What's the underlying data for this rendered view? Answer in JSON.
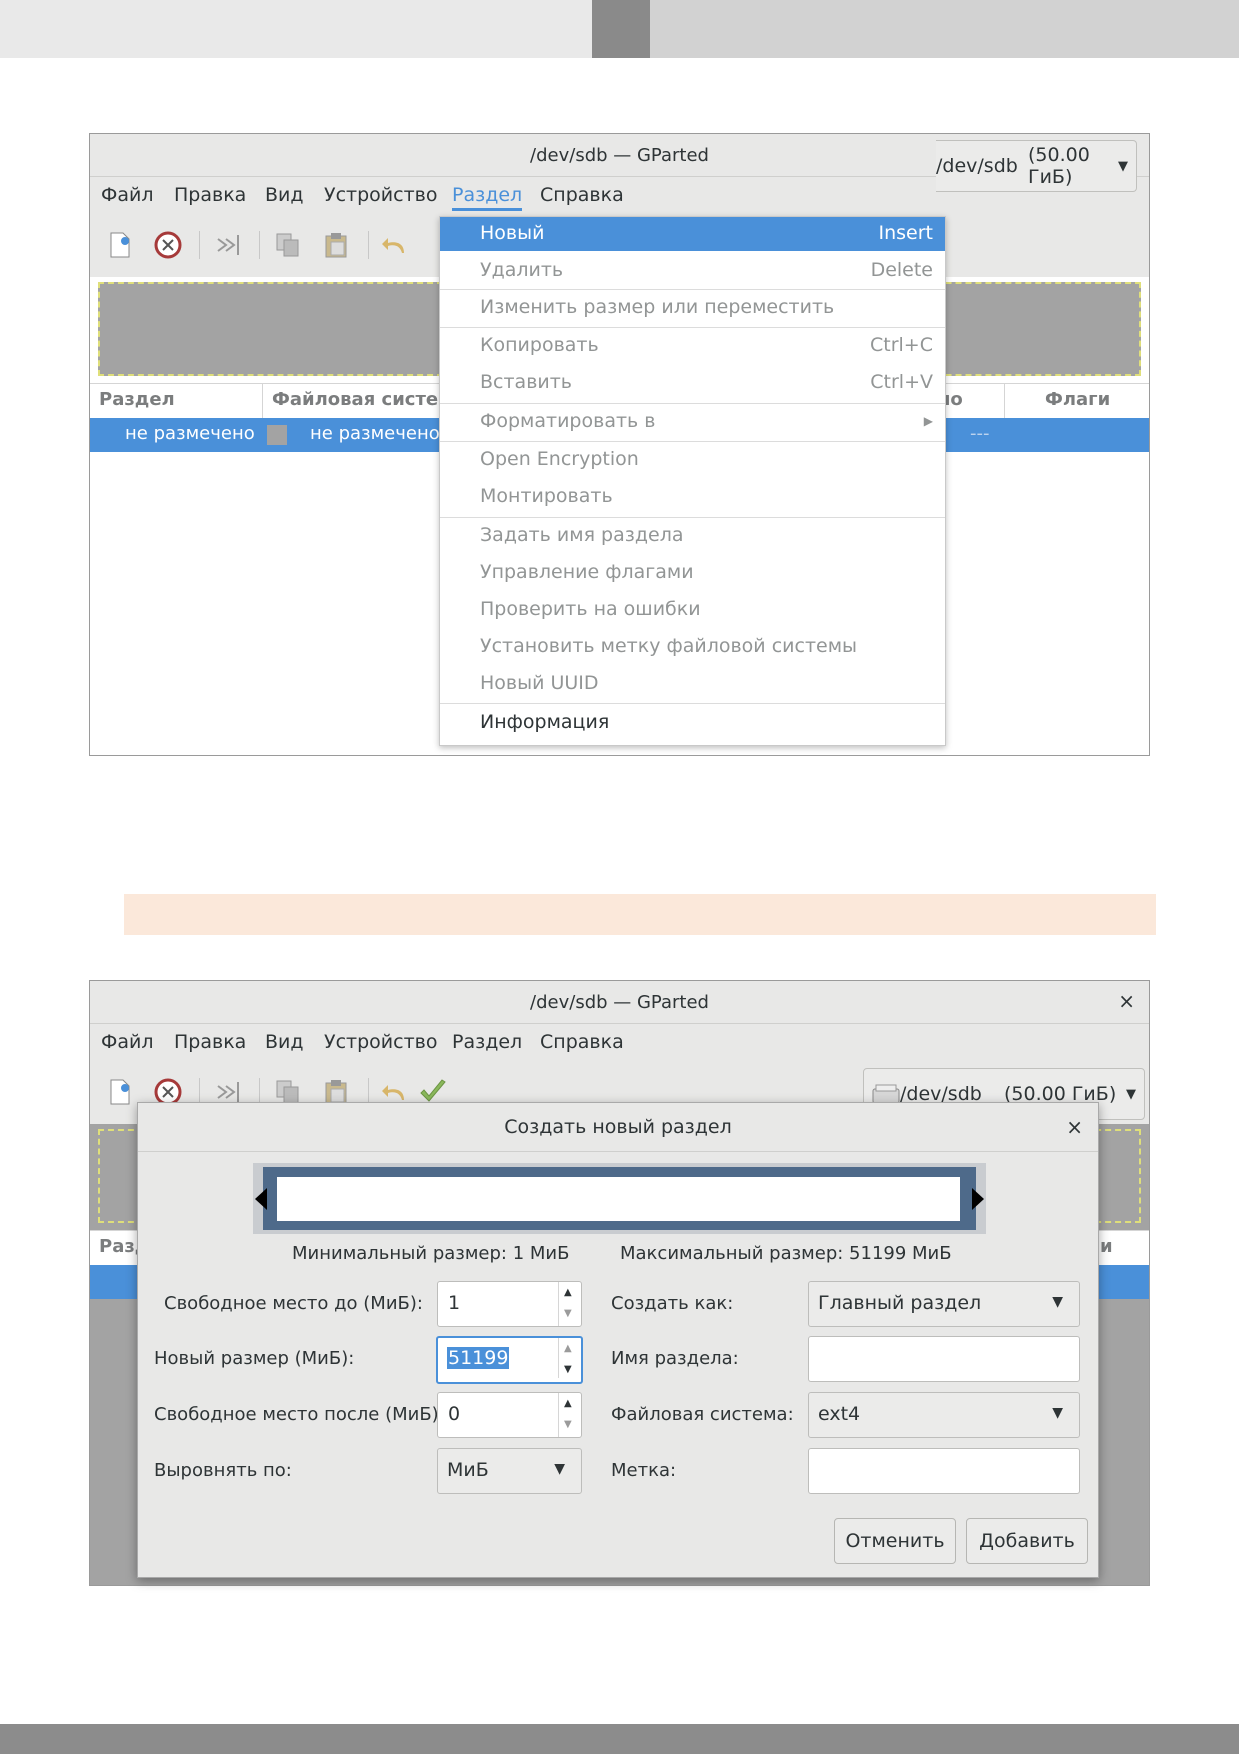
{
  "window": {
    "title": "/dev/sdb — GParted",
    "close_glyph": "×",
    "menu": [
      "Файл",
      "Правка",
      "Вид",
      "Устройство",
      "Раздел",
      "Справка"
    ],
    "device_path": "/dev/sdb",
    "device_size": "(50.00 ГиБ)",
    "columns": {
      "partition": "Раздел",
      "filesystem": "Файловая система",
      "filesystem_partial": "Файловая систем",
      "used_partial": "но",
      "flags": "Флаги",
      "partial_right": "и"
    },
    "row": {
      "partition": "не размечено",
      "filesystem": "не размечено",
      "flags": "---"
    }
  },
  "partition_menu": {
    "items": [
      {
        "label": "Новый",
        "accel": "Insert"
      },
      {
        "label": "Удалить",
        "accel": "Delete"
      },
      {
        "label": "Изменить размер или переместить",
        "accel": ""
      },
      {
        "label": "Копировать",
        "accel": "Ctrl+C"
      },
      {
        "label": "Вставить",
        "accel": "Ctrl+V"
      },
      {
        "label": "Форматировать в",
        "accel": ""
      },
      {
        "label": "Open Encryption",
        "accel": ""
      },
      {
        "label": "Монтировать",
        "accel": ""
      },
      {
        "label": "Задать имя раздела",
        "accel": ""
      },
      {
        "label": "Управление флагами",
        "accel": ""
      },
      {
        "label": "Проверить на ошибки",
        "accel": ""
      },
      {
        "label": "Установить метку файловой системы",
        "accel": ""
      },
      {
        "label": "Новый UUID",
        "accel": ""
      },
      {
        "label": "Информация",
        "accel": ""
      }
    ]
  },
  "dialog": {
    "title": "Создать новый раздел",
    "min_size": "Минимальный размер: 1 МиБ",
    "max_size": "Максимальный размер: 51199 МиБ",
    "free_before_label": "Свободное место до (МиБ):",
    "free_before_value": "1",
    "new_size_label": "Новый размер (МиБ):",
    "new_size_value": "51199",
    "free_after_label": "Свободное место после (МиБ):",
    "free_after_value": "0",
    "align_label": "Выровнять по:",
    "align_value": "МиБ",
    "create_as_label": "Создать как:",
    "create_as_value": "Главный раздел",
    "part_name_label": "Имя раздела:",
    "part_name_value": "",
    "fs_label": "Файловая система:",
    "fs_value": "ext4",
    "label_label": "Метка:",
    "label_value": "",
    "cancel": "Отменить",
    "add": "Добавить"
  },
  "icons": [
    "new-partition-icon",
    "delete-icon",
    "resize-move-icon",
    "copy-icon",
    "paste-icon",
    "undo-icon",
    "apply-icon",
    "disk-icon",
    "dropdown-arrow-icon",
    "submenu-arrow-icon",
    "spin-up-icon",
    "spin-down-icon"
  ],
  "colors": {
    "accent": "#4a90d9",
    "window_bg": "#e8e8e7",
    "graph_unallocated": "#a3a3a3",
    "graph_border": "#4e6a8a",
    "callout_bg": "#fbe8da"
  }
}
